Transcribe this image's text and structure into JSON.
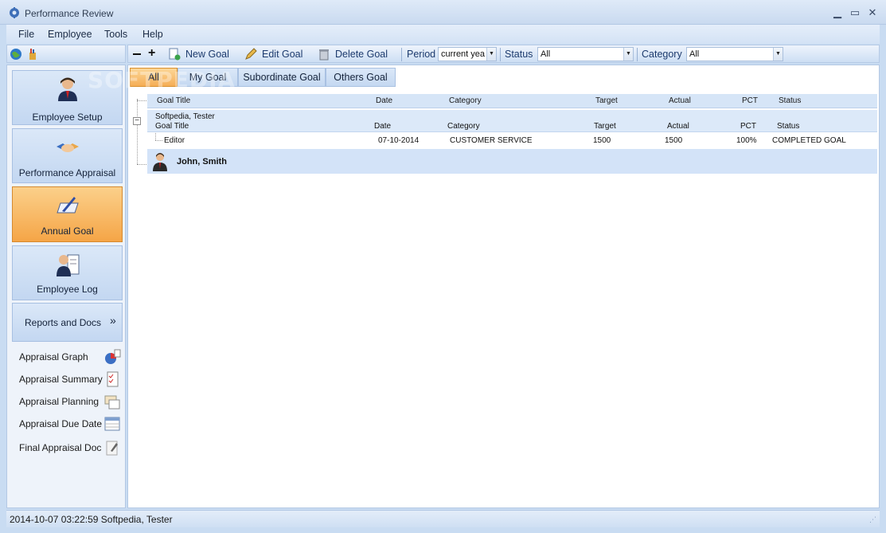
{
  "window": {
    "title": "Performance Review"
  },
  "menu": [
    "File",
    "Employee",
    "Tools",
    "Help"
  ],
  "toolbar": {
    "new_goal": "New Goal",
    "edit_goal": "Edit Goal",
    "delete_goal": "Delete Goal",
    "period_label": "Period",
    "period_value": "current yea",
    "status_label": "Status",
    "status_value": "All",
    "category_label": "Category",
    "category_value": "All"
  },
  "nav": {
    "items": [
      {
        "label": "Employee Setup",
        "icon": "employee-setup-icon"
      },
      {
        "label": "Performance Appraisal",
        "icon": "handshake-icon"
      },
      {
        "label": "Annual Goal",
        "icon": "notebook-pen-icon",
        "active": true
      },
      {
        "label": "Employee Log",
        "icon": "employee-log-icon"
      }
    ],
    "reports_label": "Reports and Docs",
    "reports": [
      {
        "label": "Appraisal Graph",
        "icon": "chart-icon"
      },
      {
        "label": "Appraisal Summary",
        "icon": "checklist-icon"
      },
      {
        "label": "Appraisal Planning",
        "icon": "planning-icon"
      },
      {
        "label": "Appraisal Due Date",
        "icon": "calendar-icon"
      },
      {
        "label": "Final Appraisal Doc",
        "icon": "document-icon"
      }
    ]
  },
  "tabs": [
    "All",
    "My Goal",
    "Subordinate Goal",
    "Others Goal"
  ],
  "grid": {
    "columns": [
      "Goal Title",
      "Date",
      "Category",
      "Target",
      "Actual",
      "PCT",
      "Status"
    ],
    "group": {
      "name": "Softpedia, Tester"
    },
    "rows": [
      {
        "title": "Editor",
        "date": "07-10-2014",
        "category": "CUSTOMER SERVICE",
        "target": "1500",
        "actual": "1500",
        "pct": "100%",
        "status": "COMPLETED GOAL"
      }
    ],
    "employee": "John, Smith"
  },
  "statusbar": {
    "text": "2014-10-07 03:22:59  Softpedia, Tester"
  },
  "watermark": "SOFTPEDIA"
}
